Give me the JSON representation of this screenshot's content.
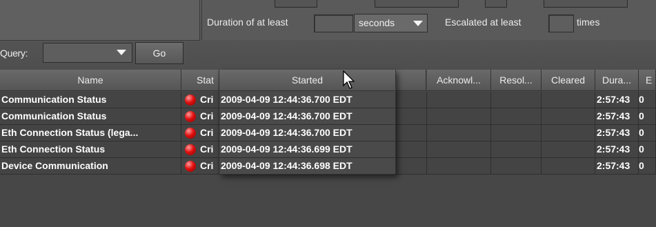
{
  "filter": {
    "duration_label": "Duration of at least",
    "duration_value": "",
    "duration_unit": "seconds",
    "escalated_label": "Escalated at least",
    "escalated_value": "",
    "times_label": "times",
    "query_label": "Query:",
    "query_value": "",
    "go_label": "Go"
  },
  "table": {
    "columns": [
      "Name",
      "Stat",
      "Started",
      "Acknowl...",
      "Resol...",
      "Cleared",
      "Dura...",
      "E"
    ],
    "rows": [
      {
        "name": "Communication Status",
        "status": "Cri",
        "started": "2009-04-09 12:44:36.700 EDT",
        "duration": "2:57:43",
        "extra": "0"
      },
      {
        "name": "Communication Status",
        "status": "Cri",
        "started": "2009-04-09 12:44:36.700 EDT",
        "duration": "2:57:43",
        "extra": "0"
      },
      {
        "name": "Eth Connection Status (lega...",
        "status": "Cri",
        "started": "2009-04-09 12:44:36.700 EDT",
        "duration": "2:57:43",
        "extra": "0"
      },
      {
        "name": "Eth Connection Status",
        "status": "Cri",
        "started": "2009-04-09 12:44:36.699 EDT",
        "duration": "2:57:43",
        "extra": "0"
      },
      {
        "name": "Device Communication",
        "status": "Cri",
        "started": "2009-04-09 12:44:36.698 EDT",
        "duration": "2:57:43",
        "extra": "0"
      }
    ]
  },
  "icons": {
    "status": "critical-red-dot-icon",
    "dropdown": "chevron-down-icon",
    "cursor": "mouse-pointer-icon"
  },
  "colors": {
    "background": "#4a4a4a",
    "critical": "#e01010"
  }
}
